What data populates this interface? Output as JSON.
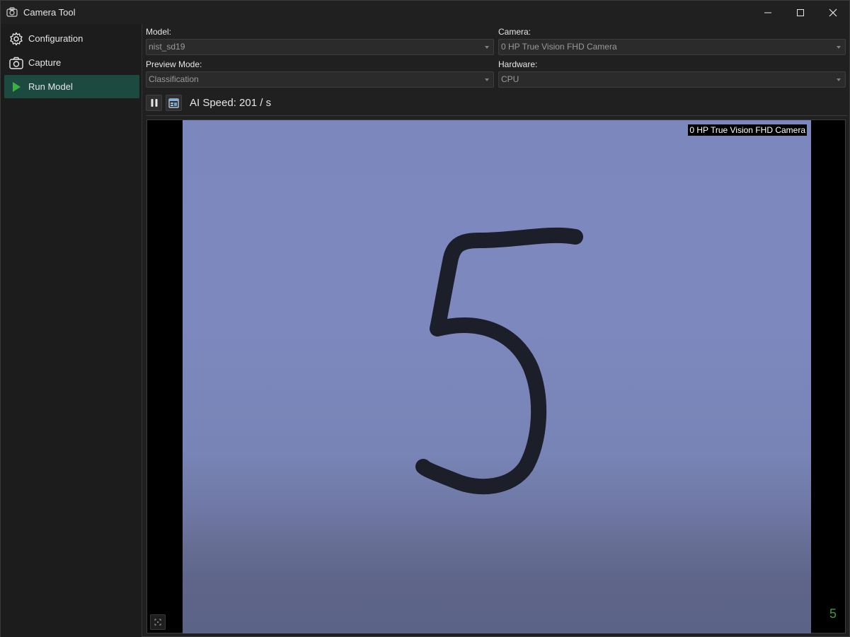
{
  "window": {
    "title": "Camera Tool",
    "icon": "camera-icon"
  },
  "sidebar": {
    "items": [
      {
        "label": "Configuration",
        "icon": "gear-icon",
        "active": false
      },
      {
        "label": "Capture",
        "icon": "camera-icon",
        "active": false
      },
      {
        "label": "Run Model",
        "icon": "play-icon",
        "active": true
      }
    ]
  },
  "form": {
    "model": {
      "label": "Model:",
      "value": "nist_sd19"
    },
    "camera": {
      "label": "Camera:",
      "value": "0 HP True Vision FHD Camera"
    },
    "preview_mode": {
      "label": "Preview Mode:",
      "value": "Classification"
    },
    "hardware": {
      "label": "Hardware:",
      "value": "CPU"
    }
  },
  "toolbar": {
    "pause_icon": "pause-icon",
    "snapshot_icon": "screenshot-icon",
    "speed_text": "AI Speed: 201 / s"
  },
  "preview": {
    "camera_label": "0 HP True Vision FHD Camera",
    "prediction": "5",
    "digit_shown": "5"
  },
  "colors": {
    "accent": "#1d4a40",
    "play": "#3cb043",
    "prediction": "#3c9a3c"
  }
}
